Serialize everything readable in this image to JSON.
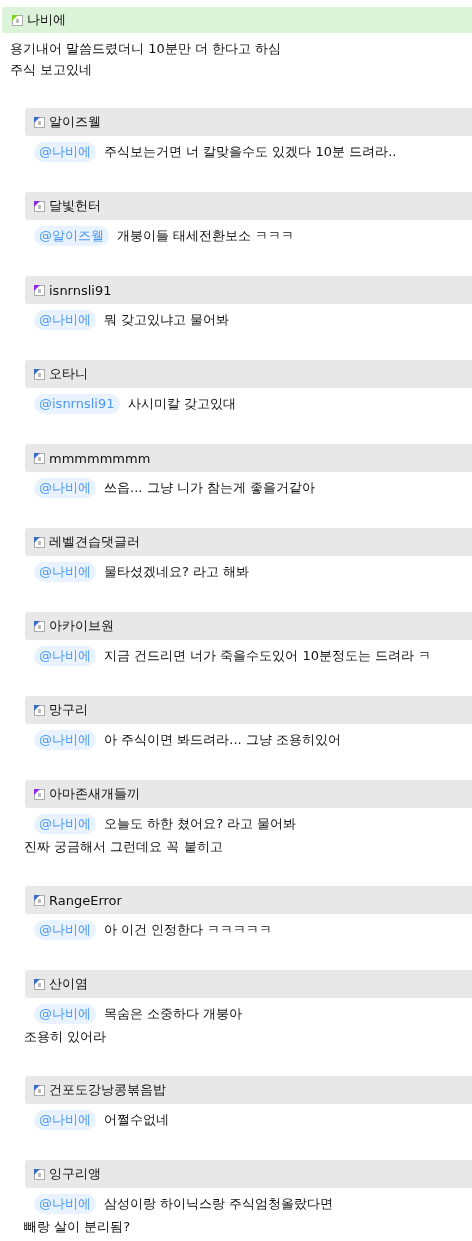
{
  "post": {
    "author": "나비에",
    "color": "#7ed321",
    "lines": [
      "용기내어 말씀드렸더니 10분만 더 한다고 하심",
      "주식 보고있네"
    ]
  },
  "comments": [
    {
      "author": "알이즈웰",
      "color": "#3a6fc4",
      "mention": "@나비에",
      "lines": [
        "주식보는거면 너 칼맞을수도 있겠다 10분 드려라.."
      ]
    },
    {
      "author": "달빛헌터",
      "color": "#8a2be2",
      "mention": "@알이즈웰",
      "lines": [
        "개붕이들 태세전환보소 ㅋㅋㅋ"
      ]
    },
    {
      "author": "isnrnsli91",
      "color": "#8a2be2",
      "mention": "@나비에",
      "lines": [
        "뭐 갖고있냐고 물어봐"
      ]
    },
    {
      "author": "오타니",
      "color": "#3a6fc4",
      "mention": "@isnrnsli91",
      "lines": [
        "사시미칼 갖고있대"
      ]
    },
    {
      "author": "mmmmmmmm",
      "color": "#3a6fc4",
      "mention": "@나비에",
      "lines": [
        "쓰읍... 그냥 니가 참는게 좋을거같아"
      ]
    },
    {
      "author": "레벨견습댓글러",
      "color": "#3a6fc4",
      "mention": "@나비에",
      "lines": [
        "물타셨겠네요? 라고 해봐"
      ]
    },
    {
      "author": "아카이브원",
      "color": "#3a6fc4",
      "mention": "@나비에",
      "lines": [
        "지금 건드리면 너가 죽을수도있어 10분정도는 드려라 ㅋ"
      ]
    },
    {
      "author": "망구리",
      "color": "#3a6fc4",
      "mention": "@나비에",
      "lines": [
        "아 주식이면 봐드려라... 그냥 조용히있어"
      ]
    },
    {
      "author": "아마존새개들끼",
      "color": "#8a2be2",
      "mention": "@나비에",
      "lines": [
        "오늘도 하한 쳤어요? 라고 물어봐",
        "진짜 궁금해서 그런데요 꼭 붙히고"
      ]
    },
    {
      "author": "RangeError",
      "color": "#3a6fc4",
      "mention": "@나비에",
      "lines": [
        "아 이건 인정한다 ㅋㅋㅋㅋㅋ"
      ]
    },
    {
      "author": "산이염",
      "color": "#3a6fc4",
      "mention": "@나비에",
      "lines": [
        "목숨은 소중하다 개붕아",
        "조용히 있어라"
      ]
    },
    {
      "author": "건포도강낭콩볶음밥",
      "color": "#3a6fc4",
      "mention": "@나비에",
      "lines": [
        "어쩔수없네"
      ]
    },
    {
      "author": "잉구리앵",
      "color": "#3a6fc4",
      "mention": "@나비에",
      "lines": [
        "삼성이랑 하이닉스랑 주식엄청올랐다면",
        "빼랑 살이 분리됨?"
      ]
    }
  ]
}
